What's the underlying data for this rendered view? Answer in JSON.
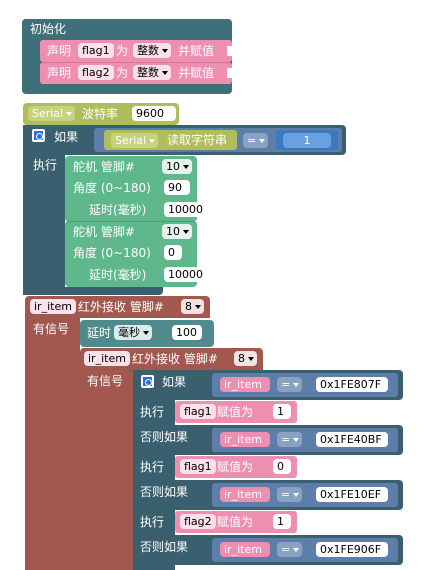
{
  "init": {
    "title": "初始化",
    "rows": [
      {
        "declare": "声明",
        "var": "flag1",
        "as": "为",
        "type": "整数",
        "assign": "并赋值"
      },
      {
        "declare": "声明",
        "var": "flag2",
        "as": "为",
        "type": "整数",
        "assign": "并赋值"
      }
    ]
  },
  "serial": {
    "name": "Serial",
    "baud_label": "波特率",
    "baud": "9600"
  },
  "if_block": {
    "if_label": "如果",
    "serial_name": "Serial",
    "read_label": "读取字符串",
    "op": "=",
    "value": "1",
    "exec_label": "执行"
  },
  "servo1": {
    "label": "舵机 管脚#",
    "pin": "10",
    "angle_label": "角度 (0~180)",
    "angle": "90",
    "delay_label": "延时(毫秒)",
    "delay": "10000"
  },
  "servo2": {
    "label": "舵机 管脚#",
    "pin": "10",
    "angle_label": "角度 (0~180)",
    "angle": "0",
    "delay_label": "延时(毫秒)",
    "delay": "10000"
  },
  "ir_outer": {
    "var": "ir_item",
    "label": "红外接收 管脚#",
    "pin": "8",
    "signal_label": "有信号"
  },
  "delay_block": {
    "label": "延时",
    "unit": "毫秒",
    "value": "100"
  },
  "ir_inner": {
    "var": "ir_item",
    "label": "红外接收 管脚#",
    "pin": "8",
    "signal_label": "有信号"
  },
  "branches": [
    {
      "kw": "如果",
      "var": "ir_item",
      "op": "=",
      "code": "0x1FE807F",
      "exec": "执行",
      "flag": "flag1",
      "assign": "赋值为",
      "val": "1"
    },
    {
      "kw": "否则如果",
      "var": "ir_item",
      "op": "=",
      "code": "0x1FE40BF",
      "exec": "执行",
      "flag": "flag1",
      "assign": "赋值为",
      "val": "0"
    },
    {
      "kw": "否则如果",
      "var": "ir_item",
      "op": "=",
      "code": "0x1FE10EF",
      "exec": "执行",
      "flag": "flag2",
      "assign": "赋值为",
      "val": "1"
    },
    {
      "kw": "否则如果",
      "var": "ir_item",
      "op": "=",
      "code": "0x1FE906F"
    }
  ],
  "colors": {
    "setup": "#3f6f77",
    "declare": "#ee8fb1",
    "serial": "#b0bd5d",
    "control": "#3a5f6e",
    "servo": "#5fb88c",
    "ir": "#a3584f",
    "delay": "#4f8b8c",
    "compare": "#5d7ea8"
  }
}
